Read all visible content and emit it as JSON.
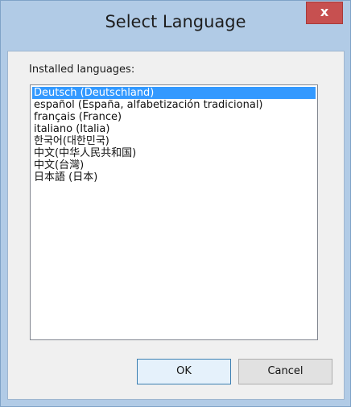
{
  "window": {
    "title": "Select Language",
    "close_label": "x"
  },
  "label": "Installed languages:",
  "languages": [
    "Deutsch (Deutschland)",
    "español (España, alfabetización tradicional)",
    "français (France)",
    "italiano (Italia)",
    "한국어(대한민국)",
    "中文(中华人民共和国)",
    "中文(台灣)",
    "日本語 (日本)"
  ],
  "selected_language": "Deutsch (Deutschland)",
  "buttons": {
    "ok": "OK",
    "cancel": "Cancel"
  },
  "colors": {
    "selection": "#3399ff",
    "close_button": "#c75050",
    "frame": "#b1cbe6"
  }
}
